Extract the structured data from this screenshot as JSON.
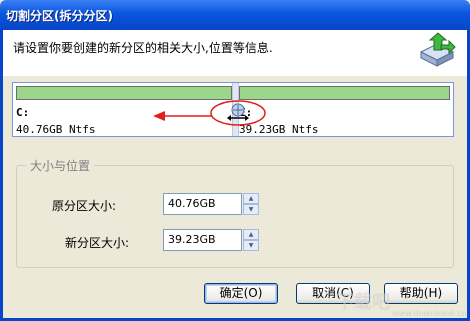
{
  "window": {
    "title": "切割分区(拆分分区)"
  },
  "header": {
    "description": "请设置你要创建的新分区的相关大小,位置等信息.",
    "icon": "partition-wizard-icon"
  },
  "disk": {
    "partitions": [
      {
        "name": "C:",
        "info": "40.76GB Ntfs"
      },
      {
        "name": "E:",
        "info": "39.23GB Ntfs"
      }
    ]
  },
  "size_position": {
    "group_label": "大小与位置",
    "original_label": "原分区大小:",
    "original_value": "40.76GB",
    "new_label": "新分区大小:",
    "new_value": "39.23GB"
  },
  "buttons": {
    "ok": "确定(O)",
    "cancel": "取消(C)",
    "help": "帮助(H)"
  },
  "watermark": {
    "text": "下载吧",
    "url": "www.downbank.cn"
  },
  "colors": {
    "partition_bar": "#9bd68a",
    "titlebar": "#0a55e0",
    "annotation": "#e11d1d"
  }
}
